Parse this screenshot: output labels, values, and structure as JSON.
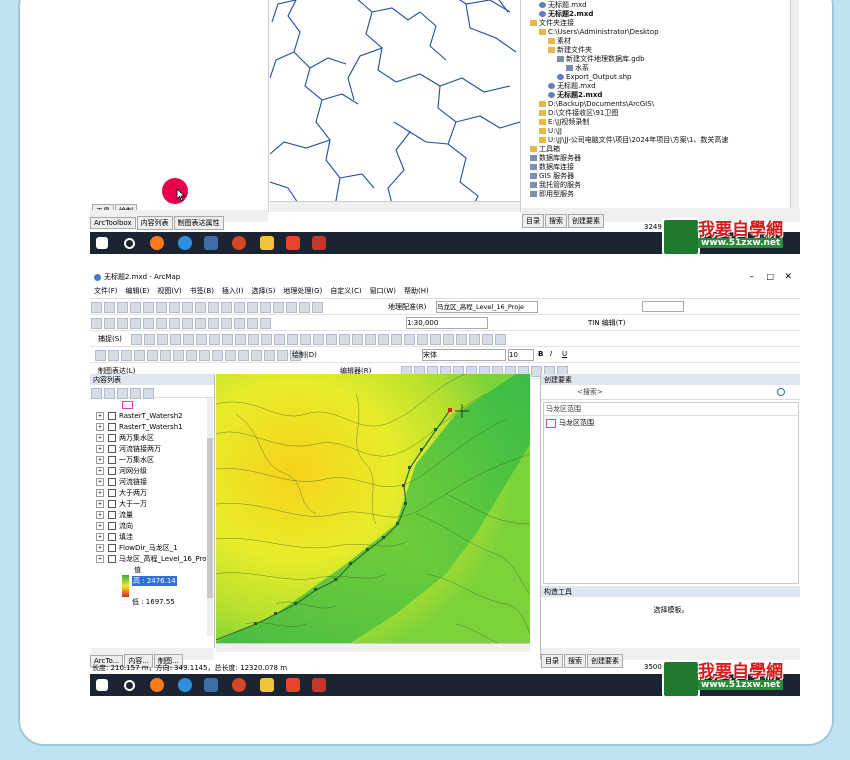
{
  "top": {
    "left_tabs": [
      "工具",
      "绘制"
    ],
    "bottom_tabs": [
      "ArcToolbox",
      "内容列表",
      "制图表达属性"
    ],
    "catalog": [
      {
        "indent": 1,
        "icon": "folder",
        "text": "素材"
      },
      {
        "indent": 1,
        "icon": "folder",
        "text": "新建文件夹"
      },
      {
        "indent": 1,
        "icon": "doc",
        "text": "无标题.mxd"
      },
      {
        "indent": 1,
        "icon": "doc",
        "text": "无标题2.mxd",
        "bold": true
      },
      {
        "indent": 0,
        "icon": "folder",
        "text": "文件夹连接"
      },
      {
        "indent": 1,
        "icon": "folder",
        "text": "C:\\Users\\Administrator\\Desktop"
      },
      {
        "indent": 2,
        "icon": "folder",
        "text": "素材"
      },
      {
        "indent": 2,
        "icon": "folder",
        "text": "新建文件夹"
      },
      {
        "indent": 3,
        "icon": "db",
        "text": "新建文件地理数据库.gdb"
      },
      {
        "indent": 4,
        "icon": "db",
        "text": "水系"
      },
      {
        "indent": 3,
        "icon": "doc",
        "text": "Export_Output.shp"
      },
      {
        "indent": 2,
        "icon": "doc",
        "text": "无标题.mxd"
      },
      {
        "indent": 2,
        "icon": "doc",
        "text": "无标题2.mxd",
        "bold": true
      },
      {
        "indent": 1,
        "icon": "folder",
        "text": "D:\\Backup\\Documents\\ArcGIS\\"
      },
      {
        "indent": 1,
        "icon": "folder",
        "text": "D:\\文件接收区\\91卫图"
      },
      {
        "indent": 1,
        "icon": "folder",
        "text": "E:\\JJ视频录制"
      },
      {
        "indent": 1,
        "icon": "folder",
        "text": "U:\\JJ"
      },
      {
        "indent": 1,
        "icon": "folder",
        "text": "U:\\JJ\\JJ-公司电脑文件\\项目\\2024年项目\\方案\\1、数关高速"
      },
      {
        "indent": 0,
        "icon": "folder",
        "text": "工具箱"
      },
      {
        "indent": 0,
        "icon": "db",
        "text": "数据库服务器"
      },
      {
        "indent": 0,
        "icon": "db",
        "text": "数据库连接"
      },
      {
        "indent": 0,
        "icon": "db",
        "text": "GIS 服务器"
      },
      {
        "indent": 0,
        "icon": "db",
        "text": "我托管的服务"
      },
      {
        "indent": 0,
        "icon": "db",
        "text": "即用型服务"
      }
    ],
    "catalog_tabs": [
      "目录",
      "搜索",
      "创建要素"
    ],
    "coord": "32496",
    "clock_time": "22:53"
  },
  "bottom": {
    "title": "无标题2.mxd - ArcMap",
    "menu": [
      "文件(F)",
      "编辑(E)",
      "视图(V)",
      "书签(B)",
      "插入(I)",
      "选择(S)",
      "地理处理(G)",
      "自定义(C)",
      "窗口(W)",
      "帮助(H)"
    ],
    "geo_menu": "地理配准(R)",
    "layer_select": "马龙区_高程_Level_16_Proje",
    "scale": "1:30,000",
    "tin_label": "TIN 编辑(T)",
    "snap_label": "捕捉(S)",
    "draw_label": "绘制(D)",
    "font": "宋体",
    "font_size": "10",
    "bold": "B",
    "italic": "I",
    "underline": "U",
    "repr_label": "制图表达(L)",
    "editor_label": "编辑器(R)",
    "toc_title": "内容列表",
    "toc": [
      {
        "text": "",
        "swatch": "#e040c0"
      },
      {
        "text": "RasterT_Watersh2"
      },
      {
        "text": "RasterT_Watersh1"
      },
      {
        "text": "两万集水区"
      },
      {
        "text": "河流链接两万"
      },
      {
        "text": "一万集水区"
      },
      {
        "text": "河网分级"
      },
      {
        "text": "河流链接"
      },
      {
        "text": "大于两万"
      },
      {
        "text": "大于一万"
      },
      {
        "text": "流量"
      },
      {
        "text": "流向"
      },
      {
        "text": "填洼"
      },
      {
        "text": "FlowDir_马龙区_1"
      },
      {
        "text": "马龙区_高程_Level_16_Pro"
      }
    ],
    "legend_value_label": "值",
    "legend_high": "高 : 2476.14",
    "legend_low": "低 : 1697.55",
    "toc_tabs": [
      "ArcTo...",
      "内容...",
      "制图..."
    ],
    "create_title": "创建要素",
    "search_placeholder": "<搜索>",
    "create_group": "马龙区范围",
    "create_item": "马龙区范围",
    "construct_title": "构造工具",
    "construct_hint": "选择模板。",
    "right_tabs": [
      "目录",
      "搜索",
      "创建要素"
    ],
    "status": "长度: 210.157 m，方向: 349.1145，总长度: 12320.078 m",
    "coord": "35001",
    "clock_time": "23:10"
  },
  "watermark": {
    "text": "我要自學網",
    "url": "www.51zxw.net"
  },
  "colors": {
    "accent_cursor": "#e8004a",
    "taskbar": "#1c2433",
    "river": "#1d4fa0"
  }
}
